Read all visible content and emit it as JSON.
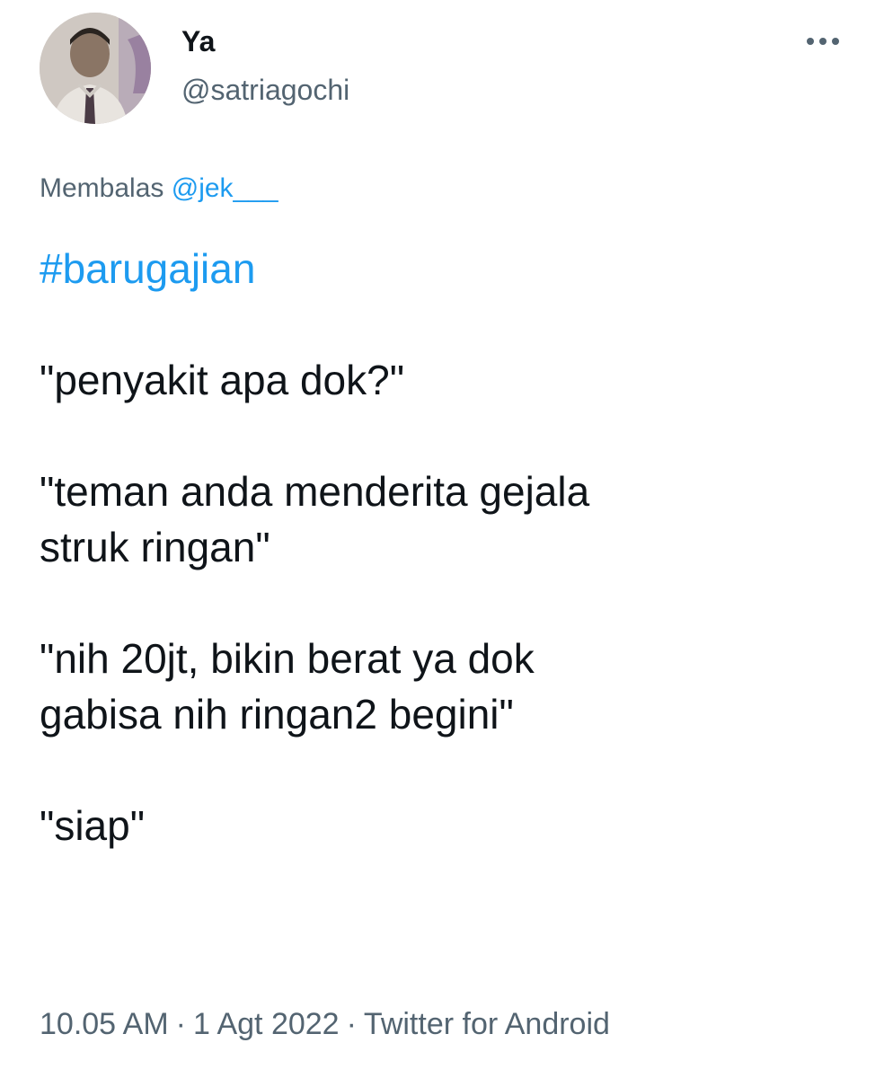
{
  "author": {
    "display_name": "Ya",
    "handle": "@satriagochi",
    "avatar_icon": "profile-photo"
  },
  "more_icon": "more-horizontal-icon",
  "reply": {
    "prefix": "Membalas",
    "mention": "@jek___"
  },
  "tweet": {
    "hashtag": "#barugajian",
    "lines": [
      "\"penyakit apa dok?\"",
      "\"teman anda menderita gejala",
      "struk ringan\"",
      "\"nih 20jt, bikin berat ya dok",
      "gabisa nih ringan2 begini\"",
      "\"siap\""
    ]
  },
  "meta": {
    "time": "10.05 AM",
    "separator": "·",
    "date": "1 Agt 2022",
    "source": "Twitter for Android"
  },
  "colors": {
    "text": "#0f1419",
    "secondary": "#536471",
    "accent": "#1d9bf0",
    "background": "#ffffff"
  }
}
